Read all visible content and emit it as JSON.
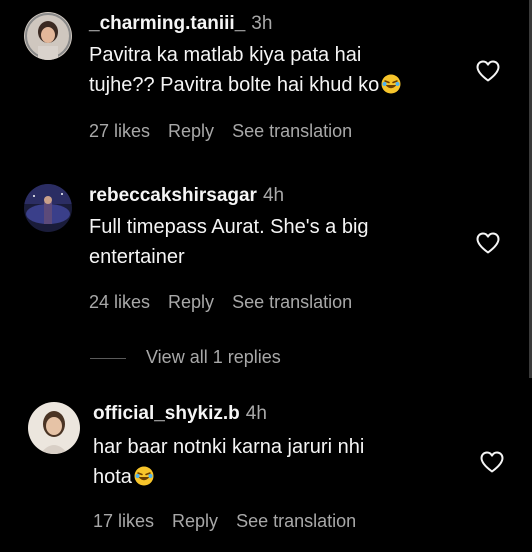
{
  "comments": [
    {
      "username": "_charming.taniii_",
      "time": "3h",
      "text_lines": [
        "Pavitra ka matlab kiya pata hai",
        "tujhe?? Pavitra bolte hai khud ko"
      ],
      "emoji": "rolling-laughing-emoji",
      "likes": "27 likes",
      "reply": "Reply",
      "translation": "See translation"
    },
    {
      "username": "rebeccakshirsagar",
      "time": "4h",
      "text_lines": [
        "Full timepass Aurat. She's a big",
        "entertainer"
      ],
      "likes": "24 likes",
      "reply": "Reply",
      "translation": "See translation"
    },
    {
      "username": "official_shykiz.b",
      "time": "4h",
      "text_lines": [
        "har baar notnki karna jaruri nhi",
        "hota"
      ],
      "emoji": "rolling-laughing-emoji",
      "likes": "17 likes",
      "reply": "Reply",
      "translation": "See translation"
    }
  ],
  "view_replies": "View all 1 replies",
  "colors": {
    "background": "#000000",
    "primary_text": "#f5f5f5",
    "secondary_text": "#a8a8a8"
  }
}
